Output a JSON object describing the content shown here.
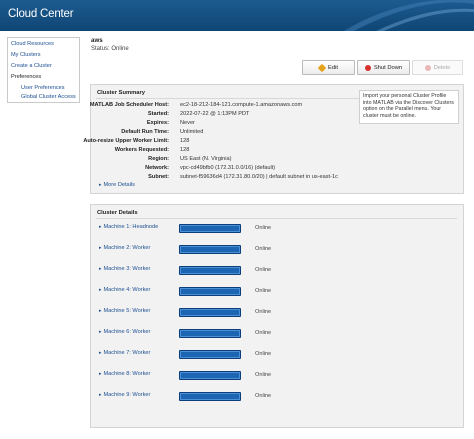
{
  "app": {
    "title": "Cloud Center"
  },
  "sidebar": {
    "items": [
      {
        "label": "Cloud Resources"
      },
      {
        "label": "My Clusters"
      },
      {
        "label": "Create a Cluster"
      },
      {
        "label": "Preferences"
      },
      {
        "label": "User Preferences"
      },
      {
        "label": "Global Cluster Access"
      }
    ]
  },
  "profile": {
    "name": "aws",
    "status": "Status: Online"
  },
  "toolbar": {
    "edit_label": "Edit",
    "shutdown_label": "Shut Down",
    "delete_label": "Delete"
  },
  "summary": {
    "title": "Cluster Summary",
    "rows": [
      {
        "label": "MATLAB Job Scheduler Host:",
        "value": "ec2-18-212-184-121.compute-1.amazonaws.com"
      },
      {
        "label": "Started:",
        "value": "2022-07-22 @ 1:13PM PDT"
      },
      {
        "label": "Expires:",
        "value": "Never"
      },
      {
        "label": "Default Run Time:",
        "value": "Unlimited"
      },
      {
        "label": "Auto-resize Upper Worker Limit:",
        "value": "128"
      },
      {
        "label": "Workers Requested:",
        "value": "128"
      },
      {
        "label": "Region:",
        "value": "US East (N. Virginia)"
      },
      {
        "label": "Network:",
        "value": "vpc-cd49bfb0 (172.31.0.0/16) (default)"
      },
      {
        "label": "Subnet:",
        "value": "subnet-f59636d4 (172.31.80.0/20) | default subnet in us-east-1c"
      }
    ],
    "note": "Import your personal Cluster Profile into MATLAB via the Discover Clusters option on the Parallel menu. Your cluster must be online.",
    "more_details": "More Details"
  },
  "details": {
    "title": "Cluster Details",
    "machines": [
      {
        "name": "Machine 1: Headnode",
        "status": "Online"
      },
      {
        "name": "Machine 2: Worker",
        "status": "Online"
      },
      {
        "name": "Machine 3: Worker",
        "status": "Online"
      },
      {
        "name": "Machine 4: Worker",
        "status": "Online"
      },
      {
        "name": "Machine 5: Worker",
        "status": "Online"
      },
      {
        "name": "Machine 6: Worker",
        "status": "Online"
      },
      {
        "name": "Machine 7: Worker",
        "status": "Online"
      },
      {
        "name": "Machine 8: Worker",
        "status": "Online"
      },
      {
        "name": "Machine 9: Worker",
        "status": "Online"
      }
    ]
  },
  "colors": {
    "header": "#0f4675",
    "link": "#1b4f90",
    "bar": "#1b65b3"
  }
}
